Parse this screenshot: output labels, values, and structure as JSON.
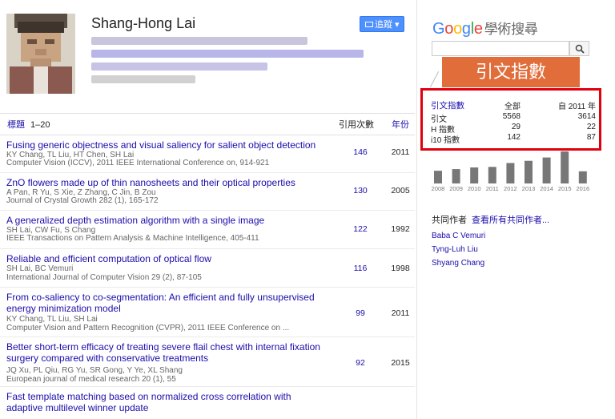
{
  "profile": {
    "name": "Shang-Hong Lai",
    "follow_label": "追蹤"
  },
  "table": {
    "header_title": "標題",
    "header_range": "1–20",
    "header_cites": "引用次數",
    "header_year": "年份",
    "rows": [
      {
        "title": "Fusing generic objectness and visual saliency for salient object detection",
        "authors": "KY Chang, TL Liu, HT Chen, SH Lai",
        "venue": "Computer Vision (ICCV), 2011 IEEE International Conference on, 914-921",
        "cites": "146",
        "year": "2011"
      },
      {
        "title": "ZnO flowers made up of thin nanosheets and their optical properties",
        "authors": "A Pan, R Yu, S Xie, Z Zhang, C Jin, B Zou",
        "venue": "Journal of Crystal Growth 282 (1), 165-172",
        "cites": "130",
        "year": "2005"
      },
      {
        "title": "A generalized depth estimation algorithm with a single image",
        "authors": "SH Lai, CW Fu, S Chang",
        "venue": "IEEE Transactions on Pattern Analysis & Machine Intelligence, 405-411",
        "cites": "122",
        "year": "1992"
      },
      {
        "title": "Reliable and efficient computation of optical flow",
        "authors": "SH Lai, BC Vemuri",
        "venue": "International Journal of Computer Vision 29 (2), 87-105",
        "cites": "116",
        "year": "1998"
      },
      {
        "title": "From co-saliency to co-segmentation: An efficient and fully unsupervised energy minimization model",
        "authors": "KY Chang, TL Liu, SH Lai",
        "venue": "Computer Vision and Pattern Recognition (CVPR), 2011 IEEE Conference on ...",
        "cites": "99",
        "year": "2011"
      },
      {
        "title": "Better short-term efficacy of treating severe flail chest with internal fixation surgery compared with conservative treatments",
        "authors": "JQ Xu, PL Qiu, RG Yu, SR Gong, Y Ye, XL Shang",
        "venue": "European journal of medical research 20 (1), 55",
        "cites": "92",
        "year": "2015"
      },
      {
        "title": "Fast template matching based on normalized cross correlation with adaptive multilevel winner update",
        "authors": "",
        "venue": "",
        "cites": "",
        "year": ""
      }
    ]
  },
  "sidebar": {
    "logo_google": "Google",
    "logo_suffix": "學術搜尋",
    "banner": "引文指數",
    "stats": {
      "title": "引文指數",
      "col_all": "全部",
      "col_since": "自 2011 年",
      "rows": [
        {
          "label": "引文",
          "all": "5568",
          "since": "3614"
        },
        {
          "label": "H 指數",
          "all": "29",
          "since": "22"
        },
        {
          "label": "i10 指數",
          "all": "142",
          "since": "87"
        }
      ]
    },
    "coauthors_label": "共同作者",
    "coauthors_link": "查看所有共同作者...",
    "coauthors": [
      "Baba C Vemuri",
      "Tyng-Luh Liu",
      "Shyang Chang"
    ]
  },
  "colors": {
    "link": "#1a0dab",
    "follow_button": "#4d90fe",
    "highlight_border": "#e0000f",
    "banner": "#e06d3a",
    "bar": "#777777"
  },
  "chart_data": {
    "type": "bar",
    "categories": [
      "2008",
      "2009",
      "2010",
      "2011",
      "2012",
      "2013",
      "2014",
      "2015",
      "2016"
    ],
    "values": [
      230,
      260,
      290,
      300,
      370,
      410,
      470,
      580,
      220
    ]
  }
}
